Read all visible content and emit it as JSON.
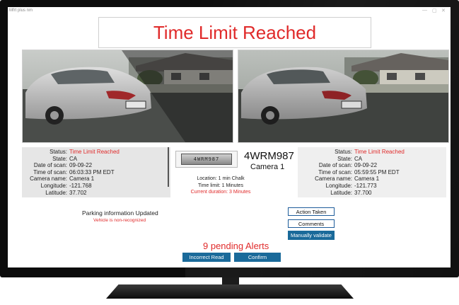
{
  "window": {
    "title": "Mfrt plus nm",
    "min": "—",
    "max": "▢",
    "close": "✕"
  },
  "banner": {
    "text": "Time Limit Reached"
  },
  "left_panel": {
    "rows": [
      {
        "label": "Status:",
        "value": "Time Limit Reached"
      },
      {
        "label": "State:",
        "value": "CA"
      },
      {
        "label": "Date of scan:",
        "value": "09-09-22"
      },
      {
        "label": "Time of scan:",
        "value": "06:03:33 PM EDT"
      },
      {
        "label": "Camera name:",
        "value": "Camera 1"
      },
      {
        "label": "Longitude:",
        "value": "-121.768"
      },
      {
        "label": "Latitude:",
        "value": "37.702"
      }
    ]
  },
  "right_panel": {
    "rows": [
      {
        "label": "Status:",
        "value": "Time Limit Reached"
      },
      {
        "label": "State:",
        "value": "CA"
      },
      {
        "label": "Date of scan:",
        "value": "09-09-22"
      },
      {
        "label": "Time of scan:",
        "value": "05:59:55 PM EDT"
      },
      {
        "label": "Camera name:",
        "value": "Camera 1"
      },
      {
        "label": "Longitude:",
        "value": "-121.773"
      },
      {
        "label": "Latitude:",
        "value": "37.700"
      }
    ]
  },
  "plate": {
    "crop_text": "4WRM987",
    "number": "4WRM987",
    "camera": "Camera 1"
  },
  "mid_info": {
    "location": "Location: 1 min Chalk",
    "time_limit": "Time limit: 1 Minutes",
    "duration": "Current duration: 3 Minutes"
  },
  "status": {
    "updated": "Parking information Updated",
    "nonrecognized": "Vehicle is non-recognized"
  },
  "actions": {
    "action_taken": "Action Taken",
    "comments": "Comments",
    "manually_validate": "Manually validate"
  },
  "alerts": {
    "pending": "9 pending Alerts"
  },
  "footer": {
    "incorrect_read": "Incorrect Read",
    "confirm": "Confirm"
  },
  "colors": {
    "alert_red": "#e02a2a",
    "button_blue": "#1a6a9a"
  }
}
